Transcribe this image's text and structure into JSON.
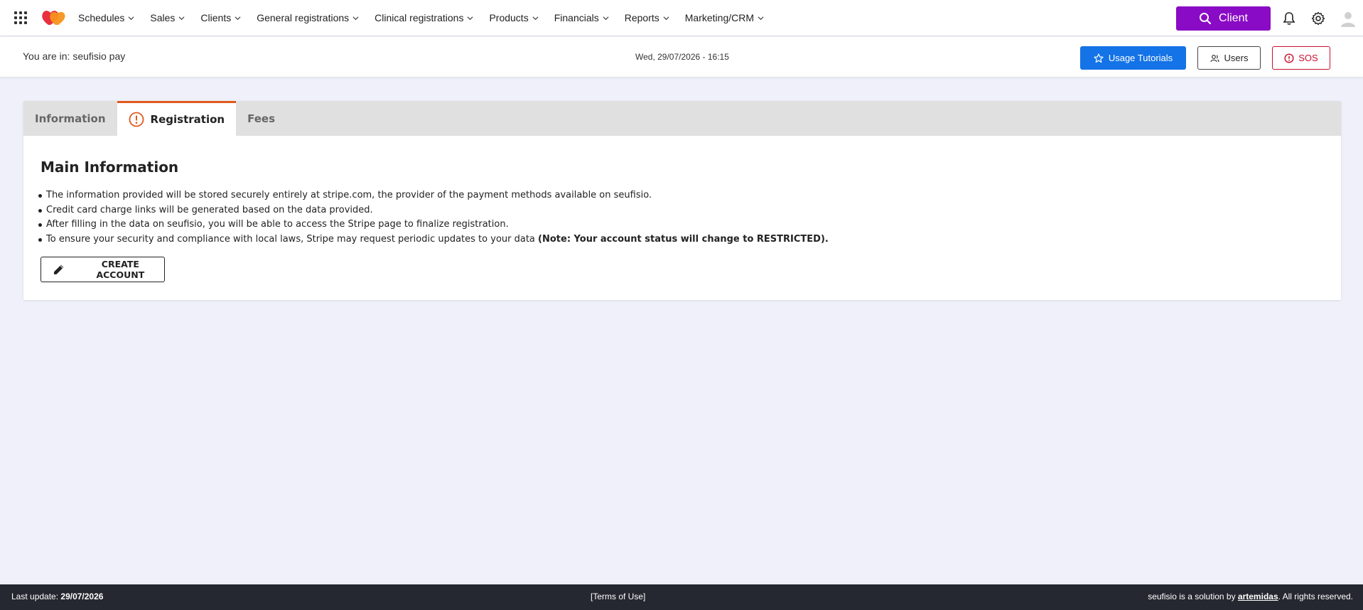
{
  "nav": {
    "menu": [
      {
        "id": "schedules",
        "label": "Schedules"
      },
      {
        "id": "sales",
        "label": "Sales"
      },
      {
        "id": "clients",
        "label": "Clients"
      },
      {
        "id": "general-registrations",
        "label": "General registrations"
      },
      {
        "id": "clinical-registrations",
        "label": "Clinical registrations"
      },
      {
        "id": "products",
        "label": "Products"
      },
      {
        "id": "financials",
        "label": "Financials"
      },
      {
        "id": "reports",
        "label": "Reports"
      },
      {
        "id": "marketing-crm",
        "label": "Marketing/CRM"
      }
    ],
    "client_button": "Client",
    "client_color": "#8a0bc5"
  },
  "subheader": {
    "breadcrumb": "You are in: seufisio pay",
    "datetime": "Wed, 29/07/2026 - 16:15",
    "tutorials_label": "Usage Tutorials",
    "users_label": "Users",
    "sos_label": "SOS"
  },
  "tabs": {
    "information": "Information",
    "registration": "Registration",
    "fees": "Fees"
  },
  "main": {
    "title": "Main Information",
    "bullets": [
      "The information provided will be stored securely entirely at stripe.com, the provider of the payment methods available on seufisio.",
      "Credit card charge links will be generated based on the data provided.",
      "After filling in the data on seufisio, you will be able to access the Stripe page to finalize registration.",
      "To ensure your security and compliance with local laws, Stripe may request periodic updates to your data "
    ],
    "note": "(Note: Your account status will change to RESTRICTED).",
    "create_button": "CREATE ACCOUNT"
  },
  "footer": {
    "last_update_label": "Last update: ",
    "last_update_date": "29/07/2026",
    "terms": "[Terms of Use]",
    "solution_prefix": "seufisio is a solution by ",
    "solution_brand": "artemidas",
    "solution_suffix": ". All rights reserved."
  },
  "colors": {
    "accent_orange": "#e05a1e",
    "tutorials_blue": "#1473e6",
    "sos_red": "#c8102e",
    "footer_bg": "#252830"
  }
}
